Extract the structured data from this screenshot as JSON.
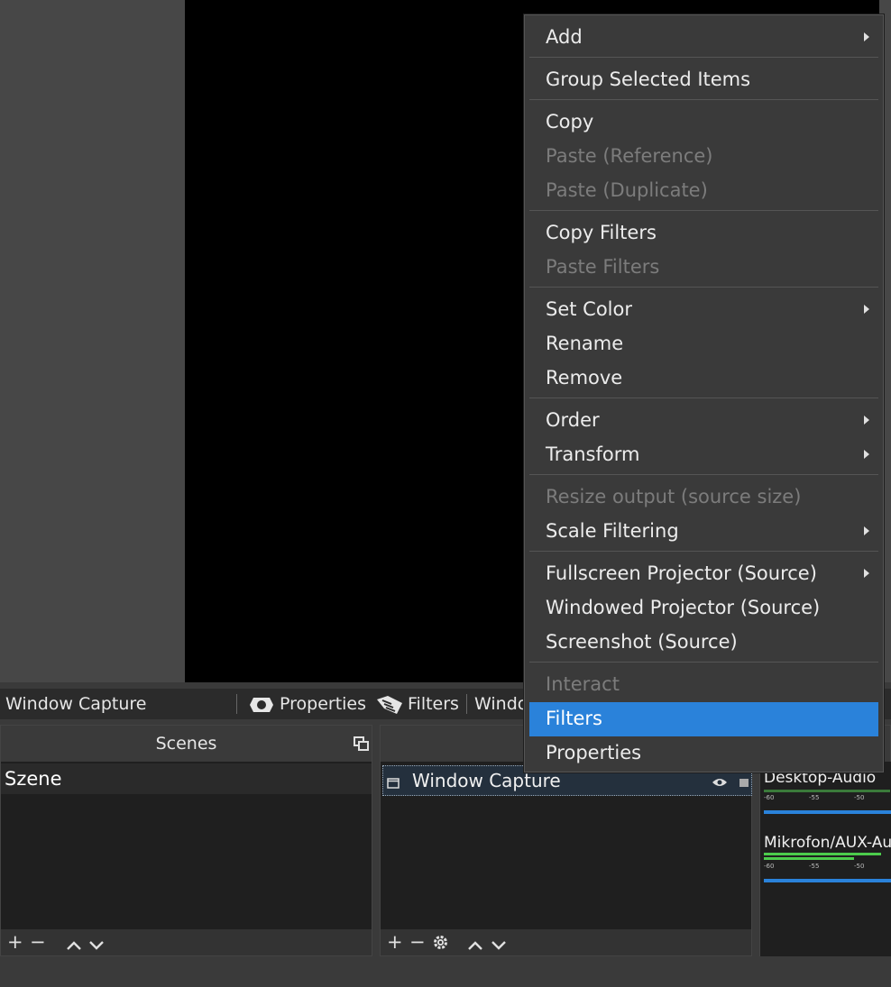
{
  "toolbar": {
    "source_name": "Window Capture",
    "properties_label": "Properties",
    "filters_label": "Filters",
    "window_label": "Windo"
  },
  "scenes_dock": {
    "title": "Scenes",
    "items": [
      "Szene"
    ]
  },
  "sources_dock": {
    "items": [
      "Window Capture"
    ]
  },
  "mixer": {
    "channels": [
      {
        "name": "Desktop-Audio",
        "ticks": [
          "-60",
          "-55",
          "-50"
        ]
      },
      {
        "name": "Mikrofon/AUX-Au",
        "ticks": [
          "-60",
          "-55",
          "-50"
        ]
      }
    ]
  },
  "context_menu": {
    "items": [
      {
        "label": "Add",
        "submenu": true
      },
      {
        "label": "Group Selected Items"
      },
      {
        "label": "Copy"
      },
      {
        "label": "Paste (Reference)",
        "disabled": true
      },
      {
        "label": "Paste (Duplicate)",
        "disabled": true
      },
      {
        "label": "Copy Filters"
      },
      {
        "label": "Paste Filters",
        "disabled": true
      },
      {
        "label": "Set Color",
        "submenu": true
      },
      {
        "label": "Rename"
      },
      {
        "label": "Remove"
      },
      {
        "label": "Order",
        "submenu": true
      },
      {
        "label": "Transform",
        "submenu": true
      },
      {
        "label": "Resize output (source size)",
        "disabled": true
      },
      {
        "label": "Scale Filtering",
        "submenu": true
      },
      {
        "label": "Fullscreen Projector (Source)",
        "submenu": true
      },
      {
        "label": "Windowed Projector (Source)"
      },
      {
        "label": "Screenshot (Source)"
      },
      {
        "label": "Interact",
        "disabled": true
      },
      {
        "label": "Filters",
        "highlighted": true
      },
      {
        "label": "Properties"
      }
    ]
  },
  "colors": {
    "highlight": "#2a82da",
    "meter_green": "#4ccc4c",
    "meter_blue": "#2a82da"
  }
}
